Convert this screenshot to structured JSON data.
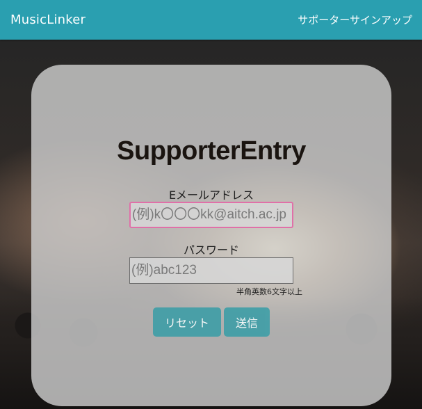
{
  "navbar": {
    "brand": "MusicLinker",
    "signup_link": "サポーターサインアップ"
  },
  "form": {
    "title": "SupporterEntry",
    "email_label": "Eメールアドレス",
    "email_placeholder": "(例)k〇〇〇kk@aitch.ac.jp",
    "password_label": "パスワード",
    "password_placeholder": "(例)abc123",
    "password_hint": "半角英数6文字以上",
    "reset_label": "リセット",
    "submit_label": "送信"
  },
  "colors": {
    "navbar": "#2a9fb0",
    "button": "#3e9ea7",
    "email_focus_border": "#e070a8"
  }
}
